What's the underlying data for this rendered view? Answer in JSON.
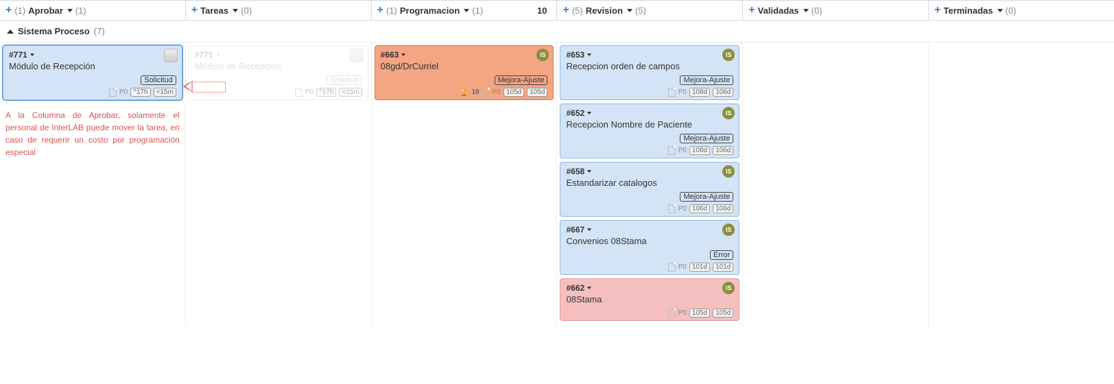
{
  "columns": [
    {
      "pre_count": "(1)",
      "title": "Aprobar",
      "post_count": "(1)",
      "right": ""
    },
    {
      "pre_count": "",
      "title": "Tareas",
      "post_count": "(0)",
      "right": ""
    },
    {
      "pre_count": "(1)",
      "title": "Programacion",
      "post_count": "(1)",
      "right": "10"
    },
    {
      "pre_count": "(5)",
      "title": "Revision",
      "post_count": "(5)",
      "right": ""
    },
    {
      "pre_count": "",
      "title": "Validadas",
      "post_count": "(0)",
      "right": ""
    },
    {
      "pre_count": "",
      "title": "Terminadas",
      "post_count": "(0)",
      "right": ""
    }
  ],
  "swimlane": {
    "title": "Sistema Proceso",
    "count": "(7)"
  },
  "annotation": "A la Columna de Aprobar, solamente el personal de InterLAB puede mover la tarea, en caso de requerir un costo por programación especial",
  "cards": {
    "aprobar_771": {
      "id": "#771",
      "title": "Módulo de Recepción",
      "tag": "Solicitud",
      "priority": "P0",
      "time_a": "^17h",
      "time_b": "<15m"
    },
    "ghost_771": {
      "id": "#771",
      "title": "Módulo de Recepción",
      "tag": "Solicitud",
      "priority": "P0",
      "time_a": "^17h",
      "time_b": "<15m"
    },
    "prog_663": {
      "id": "#663",
      "title": "08gd/DrCurriel",
      "tag": "Mejora-Ajuste",
      "priority": "P0",
      "time_a": "105d",
      "time_b": "105d",
      "trophy": "10",
      "avatar": "IS"
    },
    "rev_653": {
      "id": "#653",
      "title": "Recepcion orden de campos",
      "tag": "Mejora-Ajuste",
      "priority": "P0",
      "time_a": "108d",
      "time_b": "106d",
      "avatar": "IS"
    },
    "rev_652": {
      "id": "#652",
      "title": "Recepcion Nombre de Paciente",
      "tag": "Mejora-Ajuste",
      "priority": "P0",
      "time_a": "108d",
      "time_b": "106d",
      "avatar": "IS"
    },
    "rev_658": {
      "id": "#658",
      "title": "Estandarizar catalogos",
      "tag": "Mejora-Ajuste",
      "priority": "P0",
      "time_a": "106d",
      "time_b": "106d",
      "avatar": "IS"
    },
    "rev_667": {
      "id": "#667",
      "title": "Convenios 08Stama",
      "tag": "Error",
      "priority": "P0",
      "time_a": "101d",
      "time_b": "101d",
      "avatar": "IS"
    },
    "rev_662": {
      "id": "#662",
      "title": "08Stama",
      "tag": "",
      "priority": "P0",
      "time_a": "105d",
      "time_b": "105d",
      "avatar": "IS"
    }
  }
}
